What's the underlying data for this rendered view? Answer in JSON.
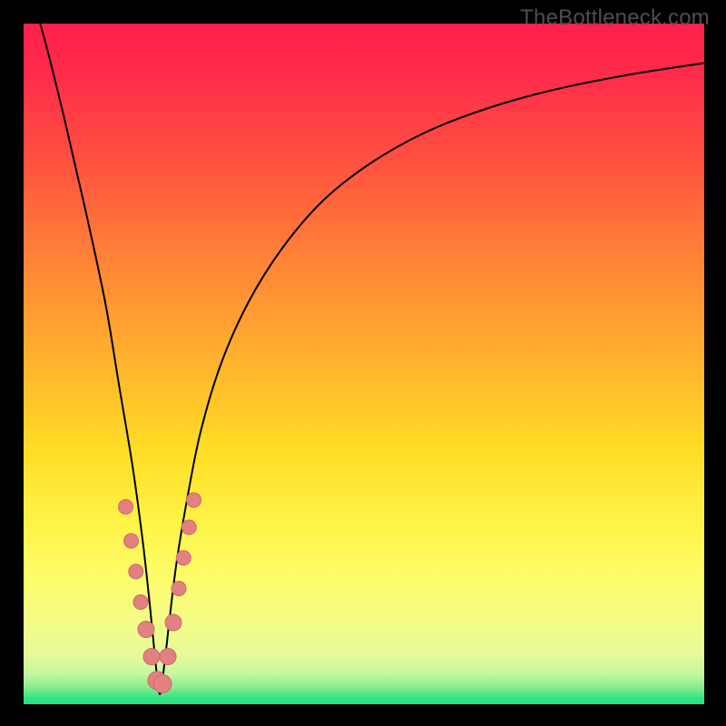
{
  "attribution": "TheBottleneck.com",
  "colors": {
    "border": "#000000",
    "curve": "#000000",
    "marker_fill": "#e38181",
    "marker_stroke": "#c96a6a",
    "gradient_stops": [
      {
        "offset": 0.0,
        "color": "#ff1f4b"
      },
      {
        "offset": 0.08,
        "color": "#ff2d4a"
      },
      {
        "offset": 0.2,
        "color": "#ff5140"
      },
      {
        "offset": 0.35,
        "color": "#ff8436"
      },
      {
        "offset": 0.5,
        "color": "#ffb32d"
      },
      {
        "offset": 0.63,
        "color": "#ffde25"
      },
      {
        "offset": 0.74,
        "color": "#fff44a"
      },
      {
        "offset": 0.82,
        "color": "#fdfd6e"
      },
      {
        "offset": 0.88,
        "color": "#f3fc86"
      },
      {
        "offset": 0.925,
        "color": "#e7fb98"
      },
      {
        "offset": 0.955,
        "color": "#c6f7a0"
      },
      {
        "offset": 0.975,
        "color": "#88ed8f"
      },
      {
        "offset": 0.99,
        "color": "#38e582"
      },
      {
        "offset": 1.0,
        "color": "#1de27f"
      }
    ]
  },
  "chart_data": {
    "type": "line",
    "title": "",
    "xlabel": "",
    "ylabel": "",
    "xlim": [
      0,
      100
    ],
    "ylim": [
      0,
      100
    ],
    "x_optimum": 20,
    "series": [
      {
        "name": "bottleneck-curve",
        "x": [
          0,
          3,
          6,
          9,
          12,
          14,
          16,
          17.5,
          18.5,
          19.3,
          20,
          20.7,
          21.5,
          22.5,
          24,
          26,
          29,
          33,
          38,
          44,
          51,
          59,
          68,
          78,
          89,
          100
        ],
        "y": [
          108,
          98,
          86,
          73,
          59,
          47,
          35,
          24,
          15,
          7,
          1.5,
          6,
          13,
          21,
          30,
          40,
          50,
          59,
          67,
          74,
          79.5,
          84,
          87.5,
          90.3,
          92.5,
          94.2
        ]
      }
    ],
    "markers": {
      "name": "sample-points",
      "x": [
        15.0,
        15.8,
        16.5,
        17.2,
        18.0,
        18.8,
        19.6,
        20.4,
        21.2,
        22.0,
        22.8,
        23.5,
        24.3,
        25.0
      ],
      "y": [
        29.0,
        24.0,
        19.5,
        15.0,
        11.0,
        7.0,
        3.5,
        3.0,
        7.0,
        12.0,
        17.0,
        21.5,
        26.0,
        30.0
      ],
      "r": [
        8,
        8,
        8,
        8,
        9,
        9,
        10,
        10,
        9,
        9,
        8,
        8,
        8,
        8
      ]
    }
  }
}
